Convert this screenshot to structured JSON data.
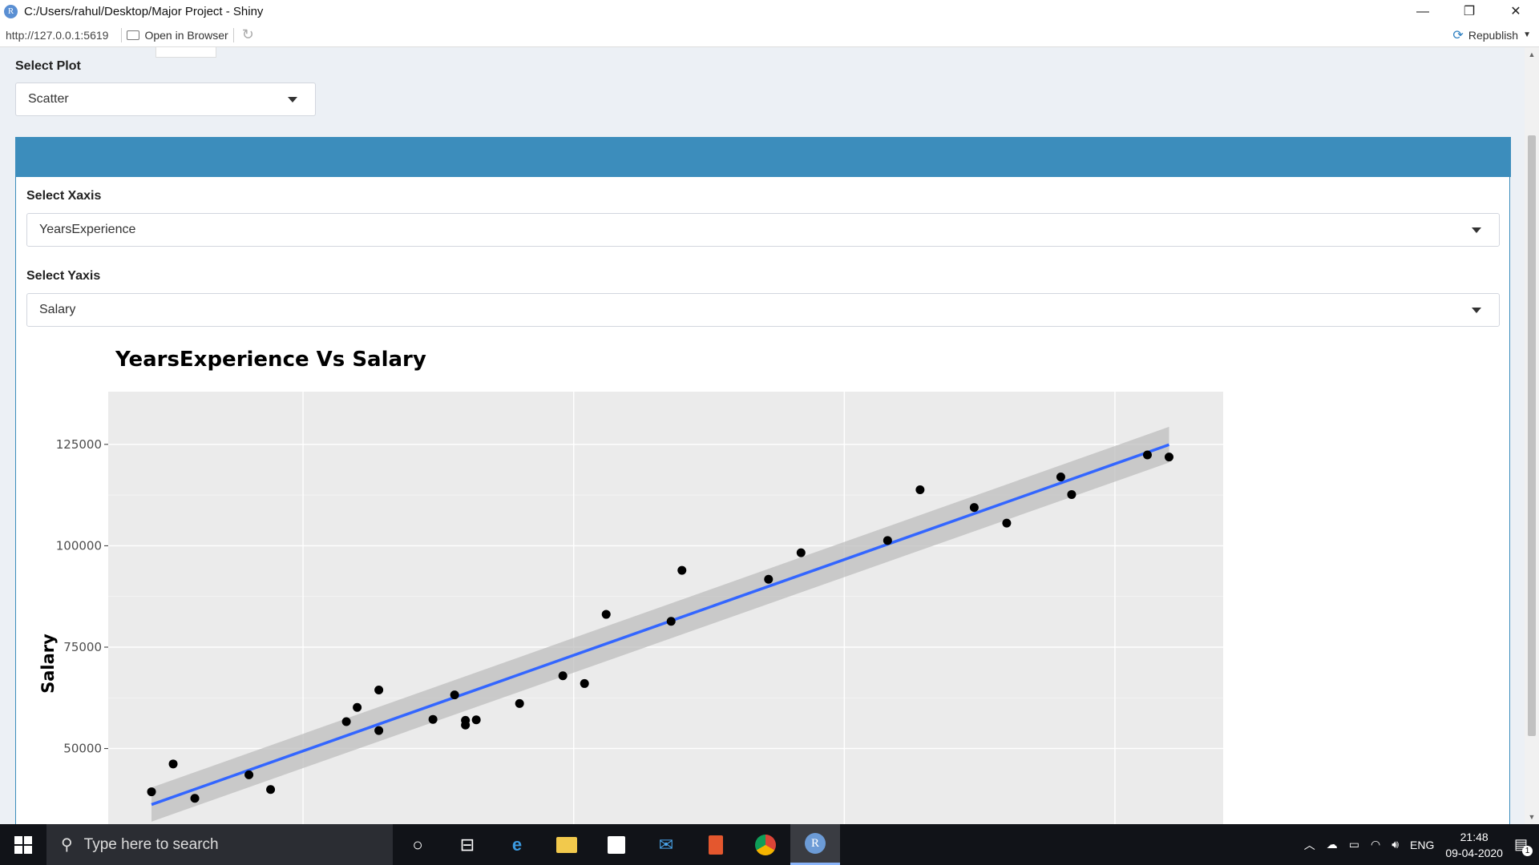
{
  "window": {
    "app_icon": "R",
    "title": "C:/Users/rahul/Desktop/Major Project - Shiny",
    "controls": {
      "minimize": "—",
      "restore": "❐",
      "close": "✕"
    }
  },
  "addressbar": {
    "url": "http://127.0.0.1:5619",
    "open_in_browser": "Open in Browser",
    "republish": "Republish"
  },
  "page": {
    "select_plot": {
      "label": "Select Plot",
      "value": "Scatter"
    },
    "select_xaxis": {
      "label": "Select Xaxis",
      "value": "YearsExperience"
    },
    "select_yaxis": {
      "label": "Select Yaxis",
      "value": "Salary"
    }
  },
  "chart_data": {
    "type": "scatter",
    "title": "YearsExperience  Vs  Salary",
    "xlabel": "",
    "ylabel": "Salary",
    "xlim": [
      0.7,
      11.0
    ],
    "ylim": [
      28000,
      138000
    ],
    "yticks": [
      50000,
      75000,
      100000,
      125000
    ],
    "ytick_labels": [
      "50000",
      "75000",
      "100000",
      "125000"
    ],
    "xtick_gridlines": [
      2.5,
      5,
      7.5,
      10
    ],
    "grid": true,
    "background": "#ebebeb",
    "point_color": "#000000",
    "series": [
      {
        "x": [
          1.1,
          1.3,
          1.5,
          2.0,
          2.2,
          2.9,
          3.0,
          3.2,
          3.2,
          3.7,
          3.9,
          4.0,
          4.0,
          4.1,
          4.5,
          4.9,
          5.1,
          5.3,
          5.9,
          6.0,
          6.8,
          7.1,
          7.9,
          8.2,
          8.7,
          9.0,
          9.5,
          9.6,
          10.3,
          10.5
        ],
        "y": [
          39343,
          46205,
          37731,
          43525,
          39891,
          56642,
          60150,
          54445,
          64445,
          57189,
          63218,
          55794,
          56957,
          57081,
          61111,
          67938,
          66029,
          83088,
          81363,
          93940,
          91738,
          98273,
          101302,
          113812,
          109431,
          105582,
          116969,
          112635,
          122391,
          121872
        ]
      }
    ],
    "trendline": {
      "color": "#3366ff",
      "band_color": "#bdbdbd",
      "x": [
        1.1,
        10.5
      ],
      "y": [
        36186,
        124923
      ],
      "band_halfwidth_y": [
        4200,
        4400
      ]
    }
  },
  "taskbar": {
    "search_placeholder": "Type here to search",
    "language": "ENG",
    "time": "21:48",
    "date": "09-04-2020",
    "notification_count": "1"
  }
}
